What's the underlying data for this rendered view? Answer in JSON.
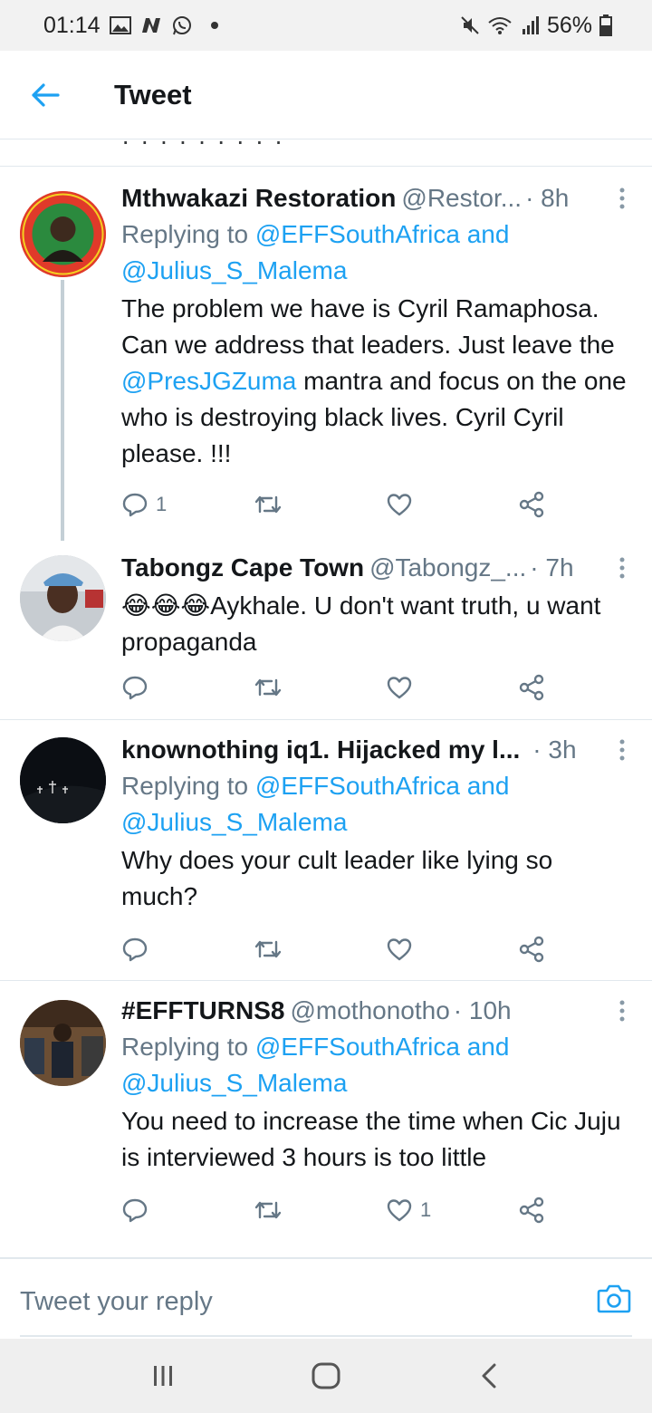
{
  "status_bar": {
    "time": "01:14",
    "battery": "56%"
  },
  "header": {
    "title": "Tweet"
  },
  "remnant_text": "· · · · · · · · ·",
  "tweets": [
    {
      "name": "Mthwakazi Restoration",
      "handle": "@Restor...",
      "time": "· 8h",
      "reply_prefix": "Replying to",
      "reply_mention_1": "@EFFSouthAfrica",
      "reply_and": "and",
      "reply_mention_2": "@Julius_S_Malema",
      "text_part_1": "The problem we have is Cyril Ramaphosa. Can we address that leaders. Just leave the ",
      "text_mention": "@PresJGZuma",
      "text_part_2": " mantra and focus on the one who is destroying black lives. Cyril Cyril please. !!!",
      "reply_count": "1",
      "like_count": ""
    },
    {
      "name": "Tabongz Cape Town",
      "handle": "@Tabongz_...",
      "time": "· 7h",
      "text": "😂😂😂Aykhale. U don't want truth, u want propaganda",
      "reply_count": "",
      "like_count": ""
    },
    {
      "name": "knownothing iq1. Hijacked my l...",
      "handle": "",
      "time": "· 3h",
      "reply_prefix": "Replying to",
      "reply_mention_1": "@EFFSouthAfrica",
      "reply_and": "and",
      "reply_mention_2": "@Julius_S_Malema",
      "text": "Why does your cult leader like lying so much?",
      "reply_count": "",
      "like_count": ""
    },
    {
      "name": "#EFFTURNS8",
      "handle": "@mothonotho",
      "time": "· 10h",
      "reply_prefix": "Replying to",
      "reply_mention_1": "@EFFSouthAfrica",
      "reply_and": "and",
      "reply_mention_2": "@Julius_S_Malema",
      "text": "You need to increase the time when Cic Juju is interviewed 3 hours is too little",
      "reply_count": "",
      "like_count": "1"
    }
  ],
  "reply_bar": {
    "placeholder": "Tweet your reply"
  },
  "colors": {
    "accent": "#1da1f2",
    "secondary_text": "#657786",
    "divider": "#e1e8ed"
  },
  "icons": [
    "back-arrow-icon",
    "more-vertical-icon",
    "reply-icon",
    "retweet-icon",
    "like-icon",
    "share-icon",
    "camera-icon",
    "recent-apps-icon",
    "home-icon",
    "back-icon"
  ]
}
